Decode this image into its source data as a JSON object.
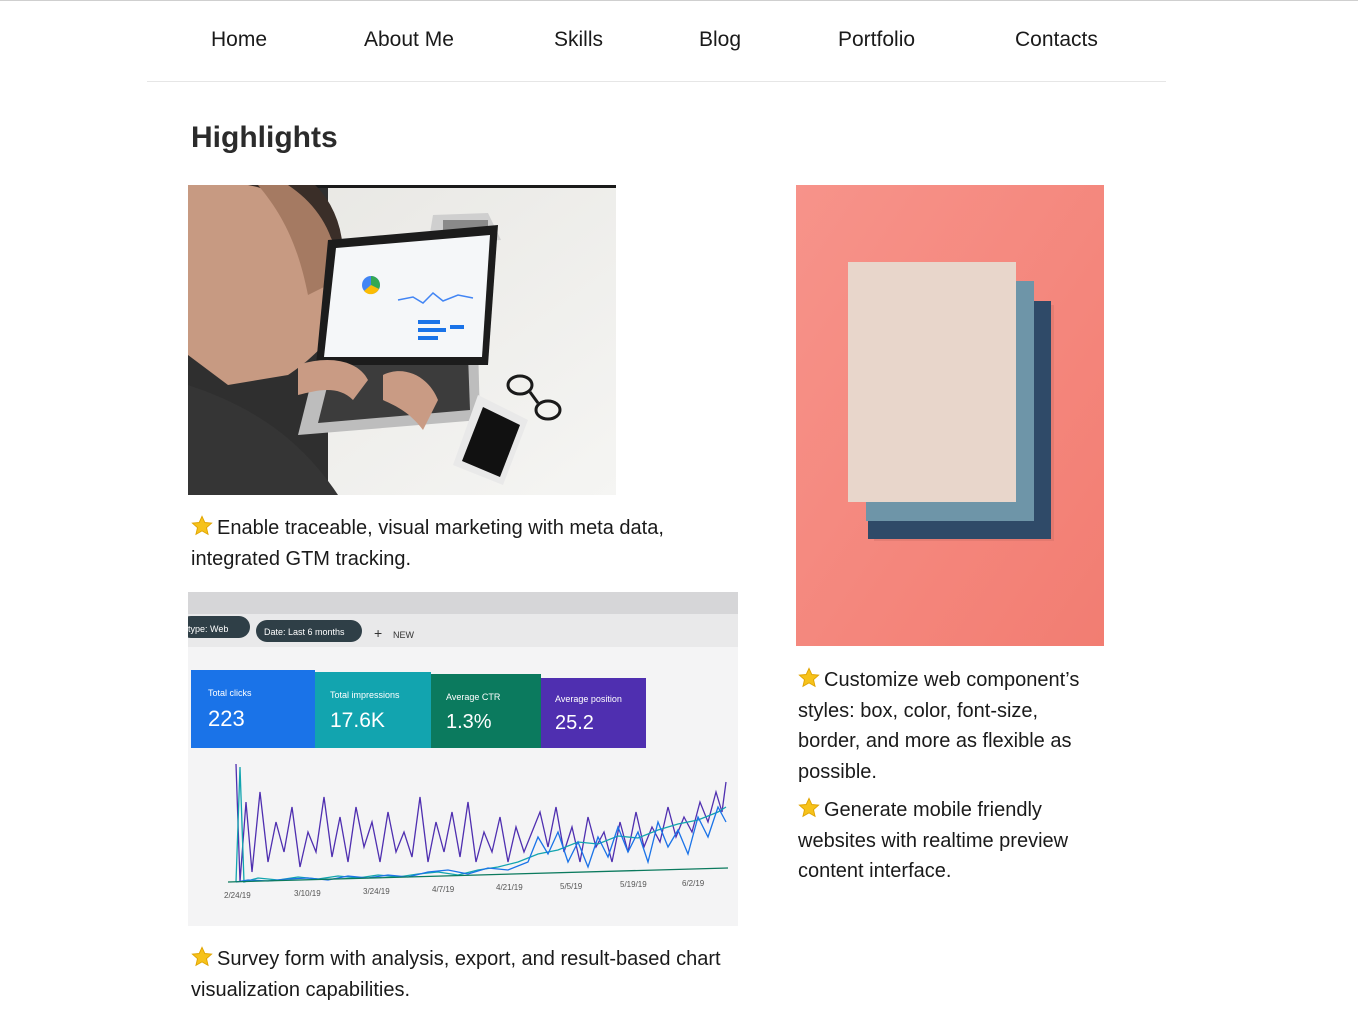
{
  "nav": {
    "items": [
      {
        "label": "Home"
      },
      {
        "label": "About Me"
      },
      {
        "label": "Skills"
      },
      {
        "label": "Blog"
      },
      {
        "label": "Portfolio"
      },
      {
        "label": "Contacts"
      }
    ]
  },
  "main": {
    "heading": "Highlights",
    "star_icon": "star-icon",
    "captions": {
      "laptop": "Enable traceable, visual marketing with meta data, integrated GTM tracking.",
      "analytics": "Survey form with analysis, export, and result-based chart visualization capabilities.",
      "paper_1": "Customize web component’s styles: box, color, font-size, border, and more as flexible as possible.",
      "paper_2": "Generate mobile friendly websites with realtime preview content interface."
    },
    "analytics_screen": {
      "filters": [
        "type: Web",
        "Date: Last 6 months"
      ],
      "new_label": "NEW",
      "cards": [
        {
          "label": "Total clicks",
          "value": "223",
          "color": "#1a73e8"
        },
        {
          "label": "Total impressions",
          "value": "17.6K",
          "color": "#12a4af"
        },
        {
          "label": "Average CTR",
          "value": "1.3%",
          "color": "#0b7a5e"
        },
        {
          "label": "Average position",
          "value": "25.2",
          "color": "#4f2fb0"
        }
      ],
      "dates": [
        "2/24/19",
        "3/10/19",
        "3/24/19",
        "4/7/19",
        "4/21/19",
        "5/5/19",
        "5/19/19",
        "6/2/19"
      ]
    },
    "colors": {
      "paper_background": "#f58a80",
      "star": "#f6c21b"
    }
  }
}
